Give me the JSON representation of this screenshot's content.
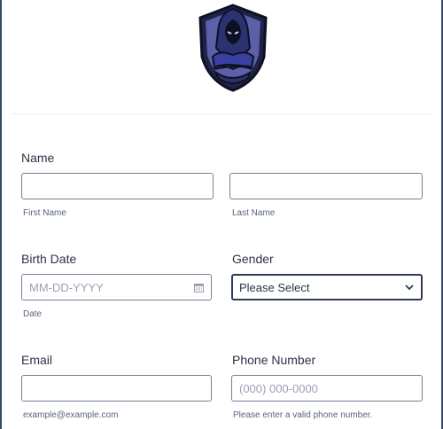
{
  "colors": {
    "border": "#7a7f95",
    "focus_border": "#2e3a56",
    "label": "#2c3345",
    "hint": "#57647e",
    "placeholder": "#9aa1b1"
  },
  "logo": {
    "icon": "hooded-figure-shield-logo"
  },
  "name": {
    "label": "Name",
    "first": {
      "value": "",
      "sublabel": "First Name"
    },
    "last": {
      "value": "",
      "sublabel": "Last Name"
    }
  },
  "birth_date": {
    "label": "Birth Date",
    "placeholder": "MM-DD-YYYY",
    "sublabel": "Date",
    "icon": "calendar-icon"
  },
  "gender": {
    "label": "Gender",
    "selected": "Please Select",
    "icon": "chevron-down-icon"
  },
  "email": {
    "label": "Email",
    "value": "",
    "sublabel": "example@example.com"
  },
  "phone": {
    "label": "Phone Number",
    "placeholder": "(000) 000-0000",
    "sublabel": "Please enter a valid phone number."
  }
}
